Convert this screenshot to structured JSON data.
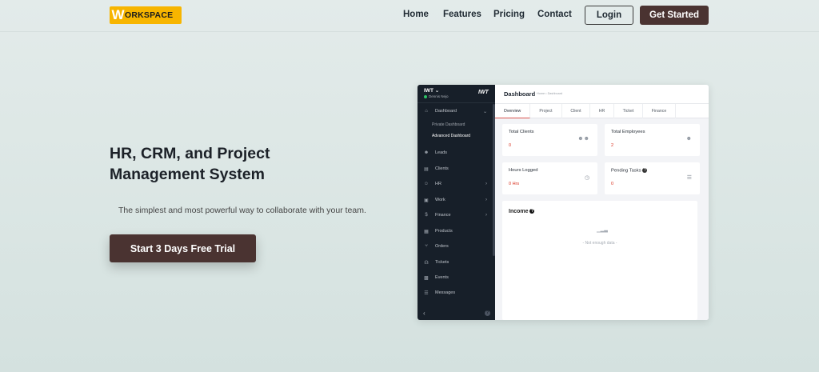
{
  "nav": {
    "logo_w": "W",
    "logo_rest": "ORKSPACE",
    "links": [
      "Home",
      "Features",
      "Pricing",
      "Contact"
    ],
    "login": "Login",
    "get_started": "Get Started"
  },
  "hero": {
    "title_line1": "HR, CRM, and Project",
    "title_line2": "Management System",
    "subtitle": "The simplest and most powerful way to collaborate with your team.",
    "cta": "Start 3 Days Free Trial"
  },
  "app": {
    "sidebar": {
      "workspace": "IWT",
      "user": "Dennis Nejo",
      "logo": "IWT",
      "items": [
        {
          "label": "Dashboard",
          "icon": "home-icon"
        },
        {
          "label": "Leads",
          "icon": "user-icon"
        },
        {
          "label": "Clients",
          "icon": "chart-icon"
        },
        {
          "label": "HR",
          "icon": "users-icon"
        },
        {
          "label": "Work",
          "icon": "briefcase-icon"
        },
        {
          "label": "Finance",
          "icon": "dollar-icon"
        },
        {
          "label": "Products",
          "icon": "box-icon"
        },
        {
          "label": "Orders",
          "icon": "cart-icon"
        },
        {
          "label": "Tickets",
          "icon": "headset-icon"
        },
        {
          "label": "Events",
          "icon": "calendar-icon"
        },
        {
          "label": "Messages",
          "icon": "message-icon"
        }
      ],
      "sub_items": [
        "Private Dashboard",
        "Advanced Dashboard"
      ]
    },
    "header": {
      "title": "Dashboard",
      "breadcrumb": "Home • Dashboard"
    },
    "tabs": [
      "Overview",
      "Project",
      "Client",
      "HR",
      "Ticket",
      "Finance"
    ],
    "cards": [
      {
        "title": "Total Clients",
        "value": "0",
        "icon": "users-icon"
      },
      {
        "title": "Total Employees",
        "value": "2",
        "icon": "user-icon"
      },
      {
        "title": "Hours Logged",
        "value": "0 Hrs",
        "icon": "clock-icon"
      },
      {
        "title": "Pending Tasks",
        "value": "0",
        "icon": "list-icon"
      }
    ],
    "income": {
      "title": "Income",
      "empty": "- Not enough data -"
    }
  },
  "colors": {
    "brand": "#f7b500",
    "primary_button": "#4a3331",
    "sidebar_bg": "#171f29",
    "value_red": "#d9311f"
  }
}
